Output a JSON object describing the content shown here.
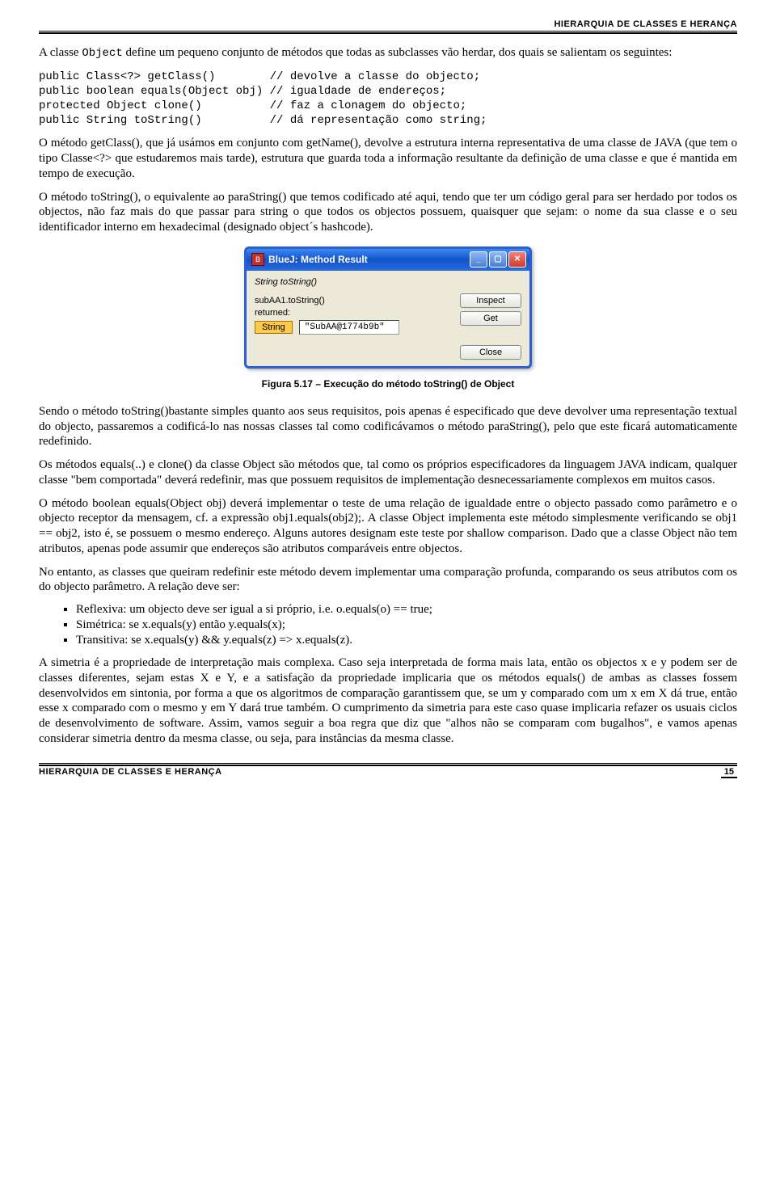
{
  "header": {
    "title": "HIERARQUIA DE CLASSES E HERANÇA"
  },
  "p1_a": "A classe ",
  "p1_b": "Object",
  "p1_c": " define um pequeno conjunto de métodos que todas as subclasses vão herdar, dos quais se salientam os seguintes:",
  "codeblock": "public Class<?> getClass()        // devolve a classe do objecto;\npublic boolean equals(Object obj) // igualdade de endereços;\nprotected Object clone()          // faz a clonagem do objecto;\npublic String toString()          // dá representação como string;",
  "p2": "O método getClass(), que já usámos em conjunto com getName(), devolve a estrutura interna representativa de uma classe de JAVA (que tem o tipo Classe<?> que estudaremos mais tarde), estrutura que guarda toda a informação resultante da definição de uma classe e que é mantida em tempo de execução.",
  "p3": "O método toString(), o equivalente ao paraString() que temos codificado até aqui, tendo que ter um código geral para ser herdado por todos os objectos, não faz mais do que passar para string o que todos os objectos possuem, quaisquer que sejam: o nome da sua classe e o seu identificador interno em hexadecimal (designado object´s hashcode).",
  "dialog": {
    "title": "BlueJ:  Method Result",
    "signature": "String toString()",
    "call": "subAA1.toString()",
    "returned_label": "returned:",
    "type": "String",
    "value": "\"SubAA@1774b9b\"",
    "inspect": "Inspect",
    "get": "Get",
    "close": "Close"
  },
  "caption": "Figura 5.17 – Execução do método toString() de Object",
  "p4": "Sendo o método toString()bastante simples quanto aos seus requisitos, pois apenas é especificado que deve devolver uma representação textual do objecto, passaremos a codificá-lo nas nossas classes tal como codificávamos o método paraString(), pelo que este ficará automaticamente redefinido.",
  "p5": "Os métodos equals(..) e clone() da classe Object são métodos que, tal como os próprios especificadores da linguagem JAVA indicam, qualquer classe \"bem comportada\" deverá redefinir, mas que possuem requisitos de implementação desnecessariamente complexos em muitos casos.",
  "p6": "O método boolean equals(Object obj) deverá implementar o teste de uma relação de igualdade entre o objecto passado como parâmetro e o objecto receptor da mensagem, cf. a expressão obj1.equals(obj2);. A classe Object implementa este método simplesmente verificando se obj1 == obj2, isto é, se possuem o mesmo endereço. Alguns autores designam este teste por shallow comparison. Dado que a classe Object não tem atributos, apenas pode assumir que endereços são atributos comparáveis entre objectos.",
  "p7": "No entanto, as classes que queiram redefinir este método devem implementar uma comparação profunda, comparando os seus atributos com os do objecto parâmetro. A relação deve ser:",
  "bullets": [
    "Reflexiva: um objecto deve ser igual a si próprio, i.e. o.equals(o) == true;",
    "Simétrica: se x.equals(y) então y.equals(x);",
    "Transitiva: se x.equals(y) && y.equals(z) => x.equals(z)."
  ],
  "p8": "A simetria é a propriedade de interpretação mais complexa. Caso seja interpretada de forma mais lata, então os objectos x e y podem ser de classes diferentes, sejam estas X e Y, e a satisfação da propriedade implicaria que os métodos equals() de ambas as classes fossem desenvolvidos em sintonia, por forma a que os algoritmos de comparação garantissem que, se um y comparado com um x em X dá true, então esse x comparado com o mesmo y em Y dará true também. O cumprimento da simetria para este caso quase implicaria refazer os usuais ciclos de desenvolvimento de software. Assim, vamos seguir a boa regra que diz que \"alhos não se comparam com bugalhos\", e vamos apenas considerar simetria dentro da mesma classe, ou seja, para instâncias da mesma classe.",
  "footer": {
    "title": "HIERARQUIA DE CLASSES E HERANÇA",
    "page": "15"
  }
}
